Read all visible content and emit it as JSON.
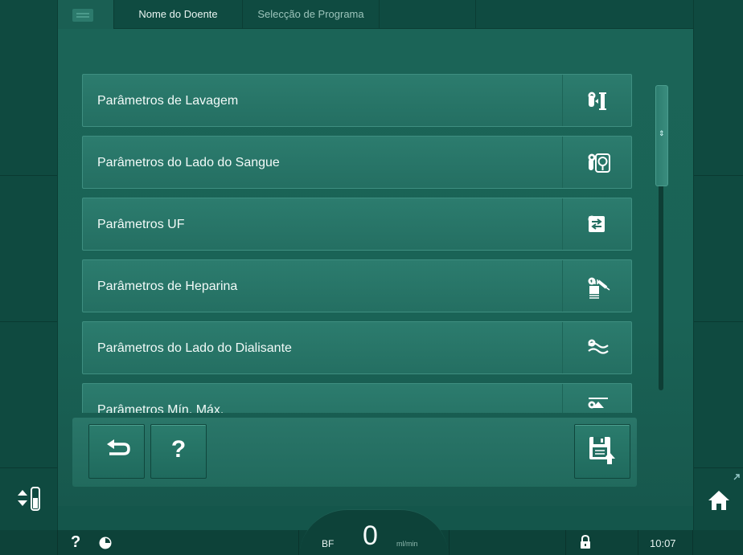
{
  "header": {
    "tabs": [
      {
        "label": "Nome do Doente"
      },
      {
        "label": "Selecção de Programa"
      }
    ]
  },
  "parameter_list": {
    "items": [
      {
        "label": "Parâmetros de Lavagem",
        "icon": "rinse-icon"
      },
      {
        "label": "Parâmetros do Lado do Sangue",
        "icon": "blood-pump-icon"
      },
      {
        "label": "Parâmetros UF",
        "icon": "uf-icon"
      },
      {
        "label": "Parâmetros de Heparina",
        "icon": "heparin-syringe-icon"
      },
      {
        "label": "Parâmetros do Lado do Dialisante",
        "icon": "dialysate-wave-icon"
      },
      {
        "label": "Parâmetros Mín. Máx.",
        "icon": "min-max-icon"
      }
    ]
  },
  "action_bar": {
    "help_label": "?"
  },
  "footer": {
    "help_label": "?",
    "bf_label": "BF",
    "bf_value": "0",
    "bf_unit": "ml/min",
    "time": "10:07"
  },
  "colors": {
    "background": "#14564b",
    "row": "#2a786a",
    "footer": "#0d4239"
  }
}
